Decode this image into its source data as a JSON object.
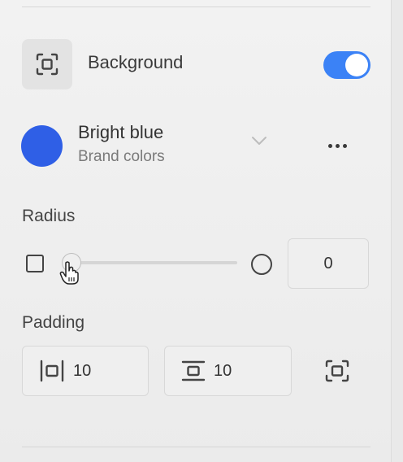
{
  "background_section": {
    "title": "Background",
    "icon": "background-frame-icon",
    "enabled": true,
    "toggle_color": "#3b82f6"
  },
  "color": {
    "name": "Bright blue",
    "group": "Brand colors",
    "swatch": "#2f5fe6"
  },
  "radius": {
    "label": "Radius",
    "value": "0",
    "slider_level": 0
  },
  "padding": {
    "label": "Padding",
    "horizontal": "10",
    "vertical": "10"
  }
}
